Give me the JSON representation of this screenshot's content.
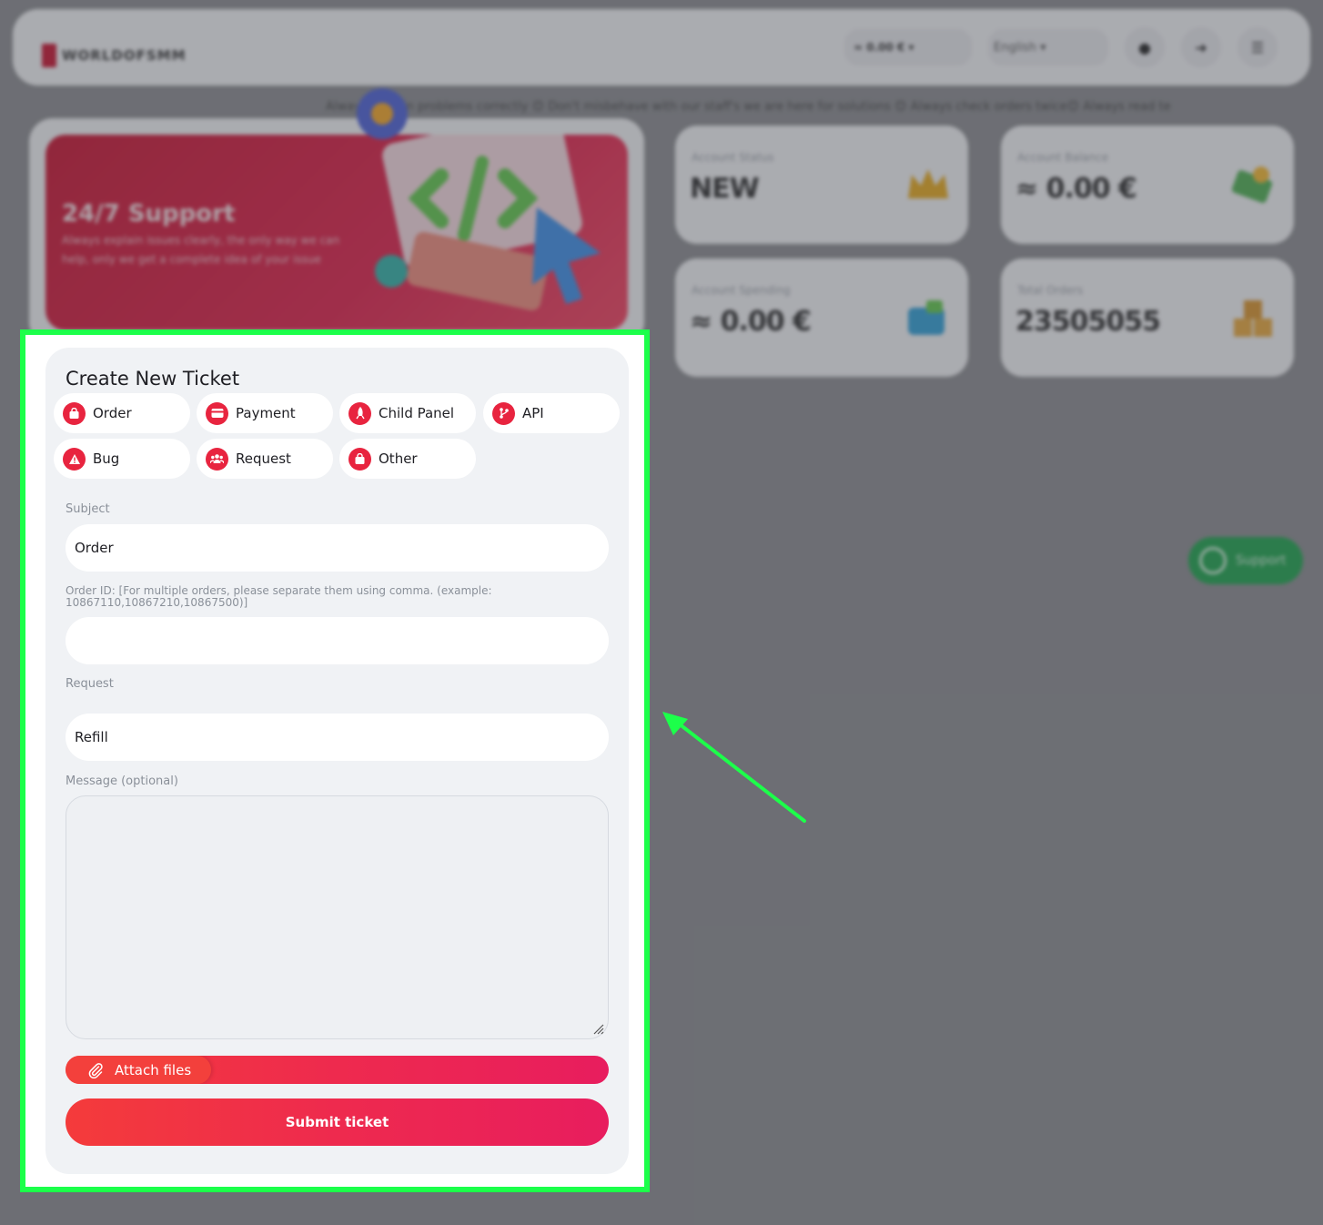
{
  "background": {
    "logo_text": "WORLDOFSMM",
    "nav": {
      "balance": "≈ 0.00 € ▾",
      "language": "English ▾"
    },
    "ticker": "Always explain problems correctly 😊 Don't misbehave with our staff's we are here for solutions 😊 Always check orders twice😊 Always read te",
    "banner": {
      "title": "24/7 Support",
      "subtitle": "Always explain issues clearly, the only way we can help, only we get a complete idea of your issue"
    },
    "stats": [
      {
        "label": "Account Status",
        "value": "NEW",
        "icon": "crown-icon"
      },
      {
        "label": "Account Balance",
        "value": "≈ 0.00 €",
        "icon": "money-icon"
      },
      {
        "label": "Account Spending",
        "value": "≈ 0.00 €",
        "icon": "wallet-icon"
      },
      {
        "label": "Total Orders",
        "value": "23505055",
        "icon": "boxes-icon"
      }
    ],
    "whatsapp_label": "Support"
  },
  "ticket": {
    "title": "Create New Ticket",
    "categories": [
      {
        "label": "Order",
        "icon": "bag-icon"
      },
      {
        "label": "Payment",
        "icon": "card-icon"
      },
      {
        "label": "Child Panel",
        "icon": "rocket-icon"
      },
      {
        "label": "API",
        "icon": "branch-icon"
      },
      {
        "label": "Bug",
        "icon": "warning-icon"
      },
      {
        "label": "Request",
        "icon": "users-icon"
      },
      {
        "label": "Other",
        "icon": "bag-icon"
      }
    ],
    "subject_label": "Subject",
    "subject_value": "Order",
    "order_id_label": "Order ID: [For multiple orders, please separate them using comma. (example: 10867110,10867210,10867500)]",
    "order_id_value": "",
    "request_label": "Request",
    "request_value": "Refill",
    "message_label": "Message (optional)",
    "message_value": "",
    "attach_label": "Attach files",
    "submit_label": "Submit ticket"
  },
  "colors": {
    "accent": "#e8243f",
    "highlight_frame": "#1cff4a",
    "card_bg": "#f0f2f5"
  }
}
